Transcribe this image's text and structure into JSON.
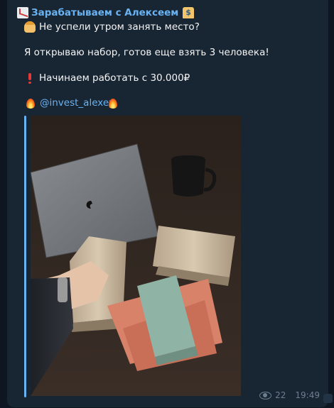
{
  "channel": {
    "name": "Зарабатываем с Алексеем"
  },
  "post": {
    "line1": "Не успели утром занять место?",
    "line2": "Я открываю набор, готов еще взять 3 человека!",
    "line3": "Начинаем работать с 30.000₽",
    "handle": "@invest_alexey"
  },
  "footer": {
    "views": "22",
    "time": "19:49"
  },
  "icons": [
    "chart-emoji",
    "bank-emoji",
    "worker-emoji",
    "exclamation-emoji",
    "fire-emoji",
    "eye-icon"
  ],
  "colors": {
    "background": "#0e1621",
    "bubble": "#182533",
    "accent": "#6ab3f3",
    "meta": "#6d7f8f"
  }
}
